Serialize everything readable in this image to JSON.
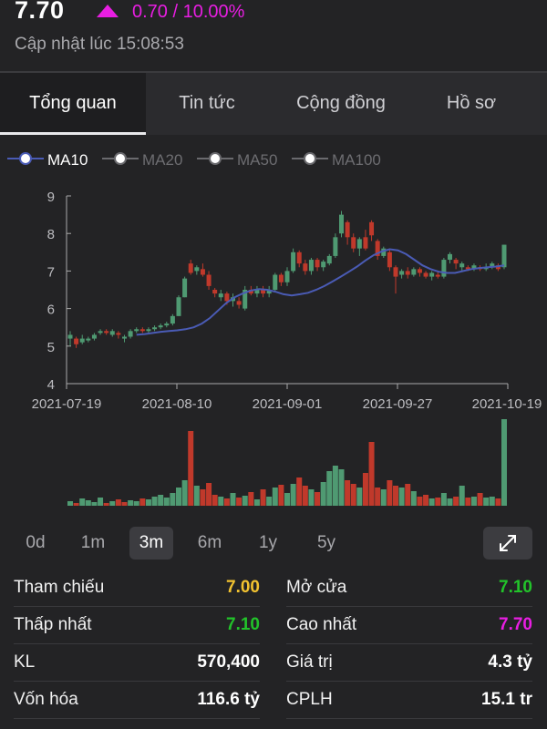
{
  "header": {
    "price": "7.70",
    "change": "0.70 / 10.00%",
    "updated": "Cập nhật lúc 15:08:53",
    "up_color": "#e81ee2"
  },
  "tabs": [
    {
      "label": "Tổng quan",
      "active": true
    },
    {
      "label": "Tin tức",
      "active": false
    },
    {
      "label": "Cộng đồng",
      "active": false
    },
    {
      "label": "Hồ sơ",
      "active": false
    }
  ],
  "legend": [
    {
      "label": "MA10",
      "active": true
    },
    {
      "label": "MA20",
      "active": false
    },
    {
      "label": "MA50",
      "active": false
    },
    {
      "label": "MA100",
      "active": false
    }
  ],
  "chart_data": {
    "type": "candlestick",
    "y_ticks": [
      "9",
      "8",
      "7",
      "6",
      "5",
      "4"
    ],
    "ylim": [
      4,
      9
    ],
    "x_ticks": [
      "2021-07-19",
      "2021-08-10",
      "2021-09-01",
      "2021-09-27",
      "2021-10-19"
    ],
    "colors": {
      "up": "#4f9a72",
      "down": "#c0392b",
      "ma10": "#4a5bb5"
    },
    "candles": [
      [
        5.2,
        5.3,
        5.0,
        5.4
      ],
      [
        5.2,
        5.05,
        4.95,
        5.25
      ],
      [
        5.1,
        5.2,
        5.05,
        5.3
      ],
      [
        5.15,
        5.2,
        5.1,
        5.25
      ],
      [
        5.2,
        5.3,
        5.15,
        5.35
      ],
      [
        5.35,
        5.4,
        5.3,
        5.45
      ],
      [
        5.4,
        5.35,
        5.3,
        5.45
      ],
      [
        5.3,
        5.4,
        5.25,
        5.45
      ],
      [
        5.35,
        5.3,
        5.2,
        5.4
      ],
      [
        5.2,
        5.25,
        5.1,
        5.3
      ],
      [
        5.25,
        5.4,
        5.2,
        5.45
      ],
      [
        5.4,
        5.45,
        5.35,
        5.5
      ],
      [
        5.45,
        5.4,
        5.35,
        5.5
      ],
      [
        5.4,
        5.45,
        5.35,
        5.5
      ],
      [
        5.45,
        5.5,
        5.4,
        5.55
      ],
      [
        5.5,
        5.55,
        5.45,
        5.6
      ],
      [
        5.55,
        5.6,
        5.5,
        5.65
      ],
      [
        5.6,
        5.8,
        5.55,
        5.85
      ],
      [
        5.8,
        6.3,
        5.8,
        6.35
      ],
      [
        6.3,
        6.8,
        6.3,
        6.85
      ],
      [
        7.2,
        6.95,
        6.9,
        7.3
      ],
      [
        7.0,
        7.1,
        6.9,
        7.15
      ],
      [
        7.05,
        6.9,
        6.85,
        7.2
      ],
      [
        6.9,
        6.6,
        6.5,
        7.0
      ],
      [
        6.5,
        6.4,
        6.3,
        6.55
      ],
      [
        6.3,
        6.4,
        6.2,
        6.5
      ],
      [
        6.4,
        6.2,
        6.1,
        6.45
      ],
      [
        6.2,
        6.3,
        6.05,
        6.4
      ],
      [
        6.2,
        6.1,
        6.0,
        6.3
      ],
      [
        6.0,
        6.5,
        5.95,
        6.6
      ],
      [
        6.5,
        6.4,
        6.35,
        6.6
      ],
      [
        6.4,
        6.5,
        6.3,
        6.6
      ],
      [
        6.5,
        6.4,
        6.3,
        6.6
      ],
      [
        6.4,
        6.5,
        6.3,
        6.6
      ],
      [
        6.5,
        6.9,
        6.45,
        6.95
      ],
      [
        6.9,
        6.7,
        6.6,
        6.95
      ],
      [
        6.7,
        7.0,
        6.6,
        7.1
      ],
      [
        7.0,
        7.5,
        6.95,
        7.6
      ],
      [
        7.5,
        7.2,
        7.1,
        7.55
      ],
      [
        7.2,
        7.0,
        6.9,
        7.3
      ],
      [
        7.0,
        7.3,
        6.9,
        7.35
      ],
      [
        7.3,
        7.1,
        7.0,
        7.35
      ],
      [
        7.1,
        7.25,
        7.0,
        7.3
      ],
      [
        7.2,
        7.4,
        7.15,
        7.45
      ],
      [
        7.4,
        7.9,
        7.35,
        8.0
      ],
      [
        8.0,
        8.5,
        7.9,
        8.6
      ],
      [
        8.3,
        7.9,
        7.7,
        8.35
      ],
      [
        7.9,
        7.6,
        7.5,
        8.0
      ],
      [
        7.6,
        7.85,
        7.4,
        7.9
      ],
      [
        7.9,
        7.6,
        7.55,
        8.1
      ],
      [
        8.3,
        7.95,
        7.8,
        8.35
      ],
      [
        7.8,
        7.4,
        7.3,
        7.85
      ],
      [
        7.4,
        7.6,
        7.35,
        7.65
      ],
      [
        7.5,
        7.1,
        7.0,
        7.6
      ],
      [
        7.1,
        6.85,
        6.4,
        7.15
      ],
      [
        6.9,
        7.0,
        6.8,
        7.05
      ],
      [
        7.0,
        6.9,
        6.8,
        7.1
      ],
      [
        6.9,
        7.05,
        6.85,
        7.1
      ],
      [
        7.05,
        6.95,
        6.85,
        7.1
      ],
      [
        6.95,
        6.85,
        6.8,
        7.0
      ],
      [
        6.85,
        6.95,
        6.75,
        7.0
      ],
      [
        6.9,
        6.85,
        6.8,
        7.0
      ],
      [
        6.85,
        7.3,
        6.8,
        7.35
      ],
      [
        7.3,
        7.45,
        7.2,
        7.5
      ],
      [
        7.3,
        7.2,
        7.05,
        7.35
      ],
      [
        7.1,
        7.2,
        7.0,
        7.25
      ],
      [
        7.1,
        7.05,
        7.0,
        7.15
      ],
      [
        7.05,
        7.15,
        7.0,
        7.2
      ],
      [
        7.1,
        7.05,
        7.0,
        7.15
      ],
      [
        7.05,
        7.1,
        7.0,
        7.2
      ],
      [
        7.1,
        7.2,
        7.05,
        7.25
      ],
      [
        7.15,
        7.05,
        7.0,
        7.2
      ],
      [
        7.1,
        7.7,
        7.05,
        7.7
      ]
    ],
    "ma10": [
      5.3,
      5.32,
      5.35,
      5.38,
      5.4,
      5.42,
      5.45,
      5.5,
      5.6,
      5.75,
      5.95,
      6.15,
      6.3,
      6.4,
      6.48,
      6.52,
      6.5,
      6.45,
      6.38,
      6.35,
      6.38,
      6.42,
      6.5,
      6.6,
      6.72,
      6.85,
      6.98,
      7.12,
      7.28,
      7.42,
      7.52,
      7.58,
      7.55,
      7.45,
      7.3,
      7.15,
      7.05,
      6.98,
      6.95,
      6.95,
      7.0,
      7.05,
      7.08,
      7.1,
      7.12,
      7.15
    ],
    "volume": [
      5,
      3,
      8,
      6,
      4,
      9,
      3,
      5,
      7,
      4,
      6,
      5,
      8,
      7,
      10,
      12,
      9,
      14,
      20,
      28,
      82,
      22,
      18,
      25,
      12,
      10,
      8,
      14,
      9,
      11,
      15,
      7,
      18,
      10,
      20,
      23,
      14,
      24,
      31,
      22,
      18,
      15,
      26,
      38,
      44,
      40,
      28,
      24,
      20,
      36,
      70,
      20,
      18,
      28,
      22,
      20,
      24,
      16,
      10,
      12,
      8,
      9,
      14,
      8,
      10,
      22,
      9,
      10,
      14,
      9,
      10,
      8,
      95
    ],
    "volume_up": [
      1,
      0,
      1,
      1,
      1,
      1,
      0,
      1,
      0,
      0,
      1,
      1,
      0,
      1,
      1,
      1,
      1,
      1,
      1,
      1,
      0,
      1,
      0,
      0,
      0,
      1,
      0,
      1,
      0,
      1,
      0,
      1,
      0,
      1,
      1,
      0,
      1,
      1,
      0,
      0,
      1,
      0,
      1,
      1,
      1,
      1,
      0,
      0,
      1,
      0,
      0,
      0,
      1,
      0,
      0,
      1,
      0,
      1,
      0,
      0,
      1,
      0,
      1,
      1,
      0,
      1,
      0,
      1,
      0,
      1,
      1,
      0,
      1
    ],
    "volume_max": 100
  },
  "ranges": [
    {
      "label": "0d",
      "active": false
    },
    {
      "label": "1m",
      "active": false
    },
    {
      "label": "3m",
      "active": true
    },
    {
      "label": "6m",
      "active": false
    },
    {
      "label": "1y",
      "active": false
    },
    {
      "label": "5y",
      "active": false
    }
  ],
  "stats": {
    "left": [
      {
        "label": "Tham chiếu",
        "value": "7.00",
        "color": "#f2c230"
      },
      {
        "label": "Thấp nhất",
        "value": "7.10",
        "color": "#22c32a"
      },
      {
        "label": "KL",
        "value": "570,400",
        "color": "#ffffff"
      },
      {
        "label": "Vốn hóa",
        "value": "116.6 tỷ",
        "color": "#ffffff"
      }
    ],
    "right": [
      {
        "label": "Mở cửa",
        "value": "7.10",
        "color": "#22c32a"
      },
      {
        "label": "Cao nhất",
        "value": "7.70",
        "color": "#e81ee2"
      },
      {
        "label": "Giá trị",
        "value": "4.3 tỷ",
        "color": "#ffffff"
      },
      {
        "label": "CPLH",
        "value": "15.1 tr",
        "color": "#ffffff"
      }
    ]
  }
}
